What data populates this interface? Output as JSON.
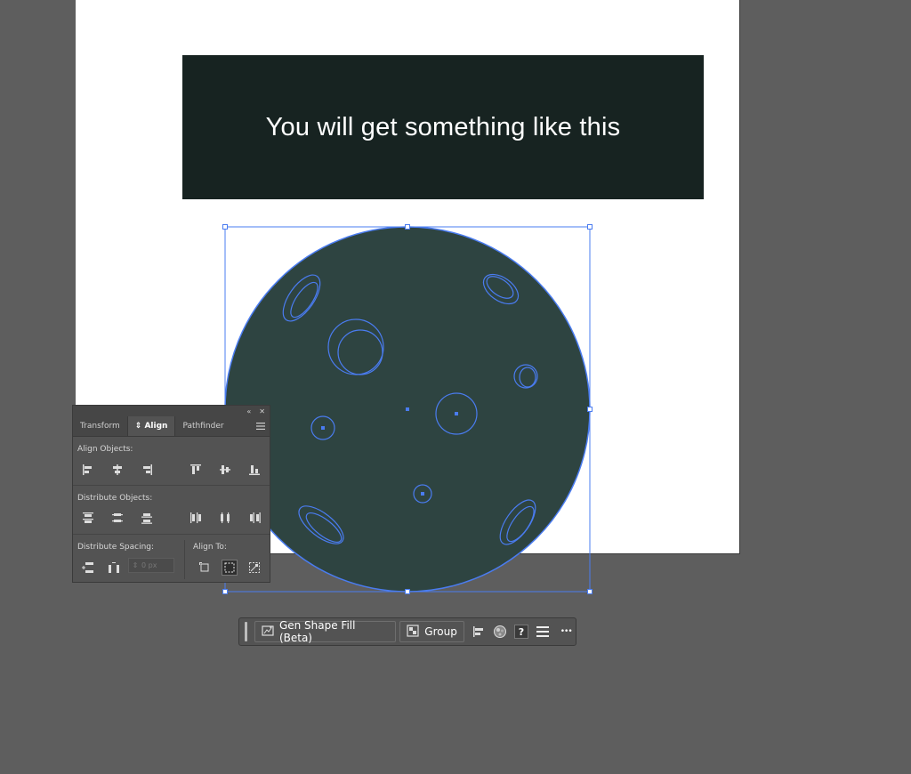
{
  "canvas": {
    "banner_text": "You will get something like this"
  },
  "colors": {
    "canvas_bg": "#5e5e5e",
    "banner_bg": "#172321",
    "moon_fill": "#2e4441",
    "selection": "#4a7cf0"
  },
  "align_panel": {
    "tabs": [
      "Transform",
      "Align",
      "Pathfinder"
    ],
    "active_tab": "Align",
    "align_objects_label": "Align Objects:",
    "distribute_objects_label": "Distribute Objects:",
    "distribute_spacing_label": "Distribute Spacing:",
    "align_to_label": "Align To:",
    "spacing_value": "0 px",
    "icons": {
      "align_objects": [
        "horizontal-align-left-icon",
        "horizontal-align-center-icon",
        "horizontal-align-right-icon",
        "vertical-align-top-icon",
        "vertical-align-center-icon",
        "vertical-align-bottom-icon"
      ],
      "distribute_objects": [
        "vertical-distribute-top-icon",
        "vertical-distribute-center-icon",
        "vertical-distribute-bottom-icon",
        "horizontal-distribute-left-icon",
        "horizontal-distribute-center-icon",
        "horizontal-distribute-right-icon"
      ],
      "align_to": [
        "align-to-artboard-icon",
        "align-to-selection-icon",
        "align-to-key-object-icon"
      ]
    }
  },
  "context_toolbar": {
    "gen_shape_fill_label": "Gen Shape Fill (Beta)",
    "group_label": "Group",
    "help_label": "?",
    "more_label": "•••"
  }
}
